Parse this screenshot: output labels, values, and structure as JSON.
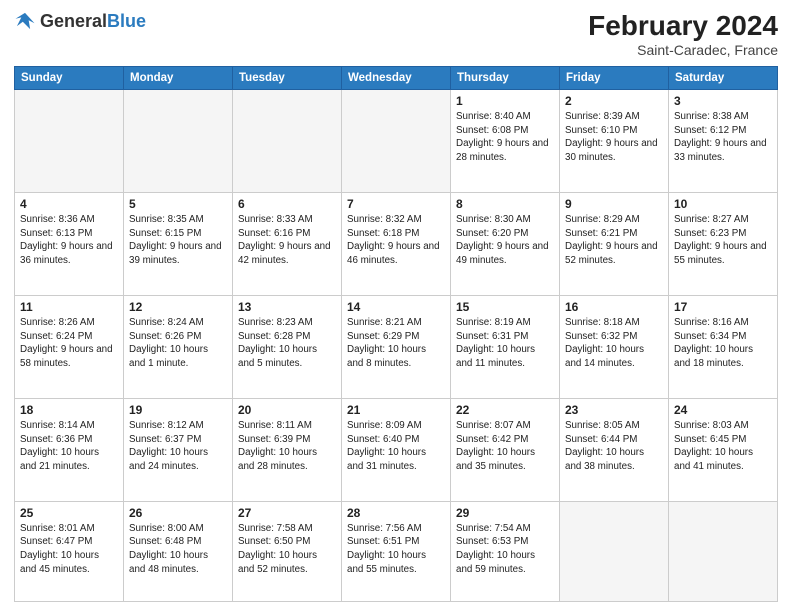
{
  "header": {
    "logo": {
      "general": "General",
      "blue": "Blue"
    },
    "title": "February 2024",
    "location": "Saint-Caradec, France"
  },
  "days": [
    "Sunday",
    "Monday",
    "Tuesday",
    "Wednesday",
    "Thursday",
    "Friday",
    "Saturday"
  ],
  "weeks": [
    [
      null,
      null,
      null,
      null,
      {
        "date": "1",
        "sunrise": "8:40 AM",
        "sunset": "6:08 PM",
        "daylight": "9 hours and 28 minutes."
      },
      {
        "date": "2",
        "sunrise": "8:39 AM",
        "sunset": "6:10 PM",
        "daylight": "9 hours and 30 minutes."
      },
      {
        "date": "3",
        "sunrise": "8:38 AM",
        "sunset": "6:12 PM",
        "daylight": "9 hours and 33 minutes."
      }
    ],
    [
      {
        "date": "4",
        "sunrise": "8:36 AM",
        "sunset": "6:13 PM",
        "daylight": "9 hours and 36 minutes."
      },
      {
        "date": "5",
        "sunrise": "8:35 AM",
        "sunset": "6:15 PM",
        "daylight": "9 hours and 39 minutes."
      },
      {
        "date": "6",
        "sunrise": "8:33 AM",
        "sunset": "6:16 PM",
        "daylight": "9 hours and 42 minutes."
      },
      {
        "date": "7",
        "sunrise": "8:32 AM",
        "sunset": "6:18 PM",
        "daylight": "9 hours and 46 minutes."
      },
      {
        "date": "8",
        "sunrise": "8:30 AM",
        "sunset": "6:20 PM",
        "daylight": "9 hours and 49 minutes."
      },
      {
        "date": "9",
        "sunrise": "8:29 AM",
        "sunset": "6:21 PM",
        "daylight": "9 hours and 52 minutes."
      },
      {
        "date": "10",
        "sunrise": "8:27 AM",
        "sunset": "6:23 PM",
        "daylight": "9 hours and 55 minutes."
      }
    ],
    [
      {
        "date": "11",
        "sunrise": "8:26 AM",
        "sunset": "6:24 PM",
        "daylight": "9 hours and 58 minutes."
      },
      {
        "date": "12",
        "sunrise": "8:24 AM",
        "sunset": "6:26 PM",
        "daylight": "10 hours and 1 minute."
      },
      {
        "date": "13",
        "sunrise": "8:23 AM",
        "sunset": "6:28 PM",
        "daylight": "10 hours and 5 minutes."
      },
      {
        "date": "14",
        "sunrise": "8:21 AM",
        "sunset": "6:29 PM",
        "daylight": "10 hours and 8 minutes."
      },
      {
        "date": "15",
        "sunrise": "8:19 AM",
        "sunset": "6:31 PM",
        "daylight": "10 hours and 11 minutes."
      },
      {
        "date": "16",
        "sunrise": "8:18 AM",
        "sunset": "6:32 PM",
        "daylight": "10 hours and 14 minutes."
      },
      {
        "date": "17",
        "sunrise": "8:16 AM",
        "sunset": "6:34 PM",
        "daylight": "10 hours and 18 minutes."
      }
    ],
    [
      {
        "date": "18",
        "sunrise": "8:14 AM",
        "sunset": "6:36 PM",
        "daylight": "10 hours and 21 minutes."
      },
      {
        "date": "19",
        "sunrise": "8:12 AM",
        "sunset": "6:37 PM",
        "daylight": "10 hours and 24 minutes."
      },
      {
        "date": "20",
        "sunrise": "8:11 AM",
        "sunset": "6:39 PM",
        "daylight": "10 hours and 28 minutes."
      },
      {
        "date": "21",
        "sunrise": "8:09 AM",
        "sunset": "6:40 PM",
        "daylight": "10 hours and 31 minutes."
      },
      {
        "date": "22",
        "sunrise": "8:07 AM",
        "sunset": "6:42 PM",
        "daylight": "10 hours and 35 minutes."
      },
      {
        "date": "23",
        "sunrise": "8:05 AM",
        "sunset": "6:44 PM",
        "daylight": "10 hours and 38 minutes."
      },
      {
        "date": "24",
        "sunrise": "8:03 AM",
        "sunset": "6:45 PM",
        "daylight": "10 hours and 41 minutes."
      }
    ],
    [
      {
        "date": "25",
        "sunrise": "8:01 AM",
        "sunset": "6:47 PM",
        "daylight": "10 hours and 45 minutes."
      },
      {
        "date": "26",
        "sunrise": "8:00 AM",
        "sunset": "6:48 PM",
        "daylight": "10 hours and 48 minutes."
      },
      {
        "date": "27",
        "sunrise": "7:58 AM",
        "sunset": "6:50 PM",
        "daylight": "10 hours and 52 minutes."
      },
      {
        "date": "28",
        "sunrise": "7:56 AM",
        "sunset": "6:51 PM",
        "daylight": "10 hours and 55 minutes."
      },
      {
        "date": "29",
        "sunrise": "7:54 AM",
        "sunset": "6:53 PM",
        "daylight": "10 hours and 59 minutes."
      },
      null,
      null
    ]
  ]
}
